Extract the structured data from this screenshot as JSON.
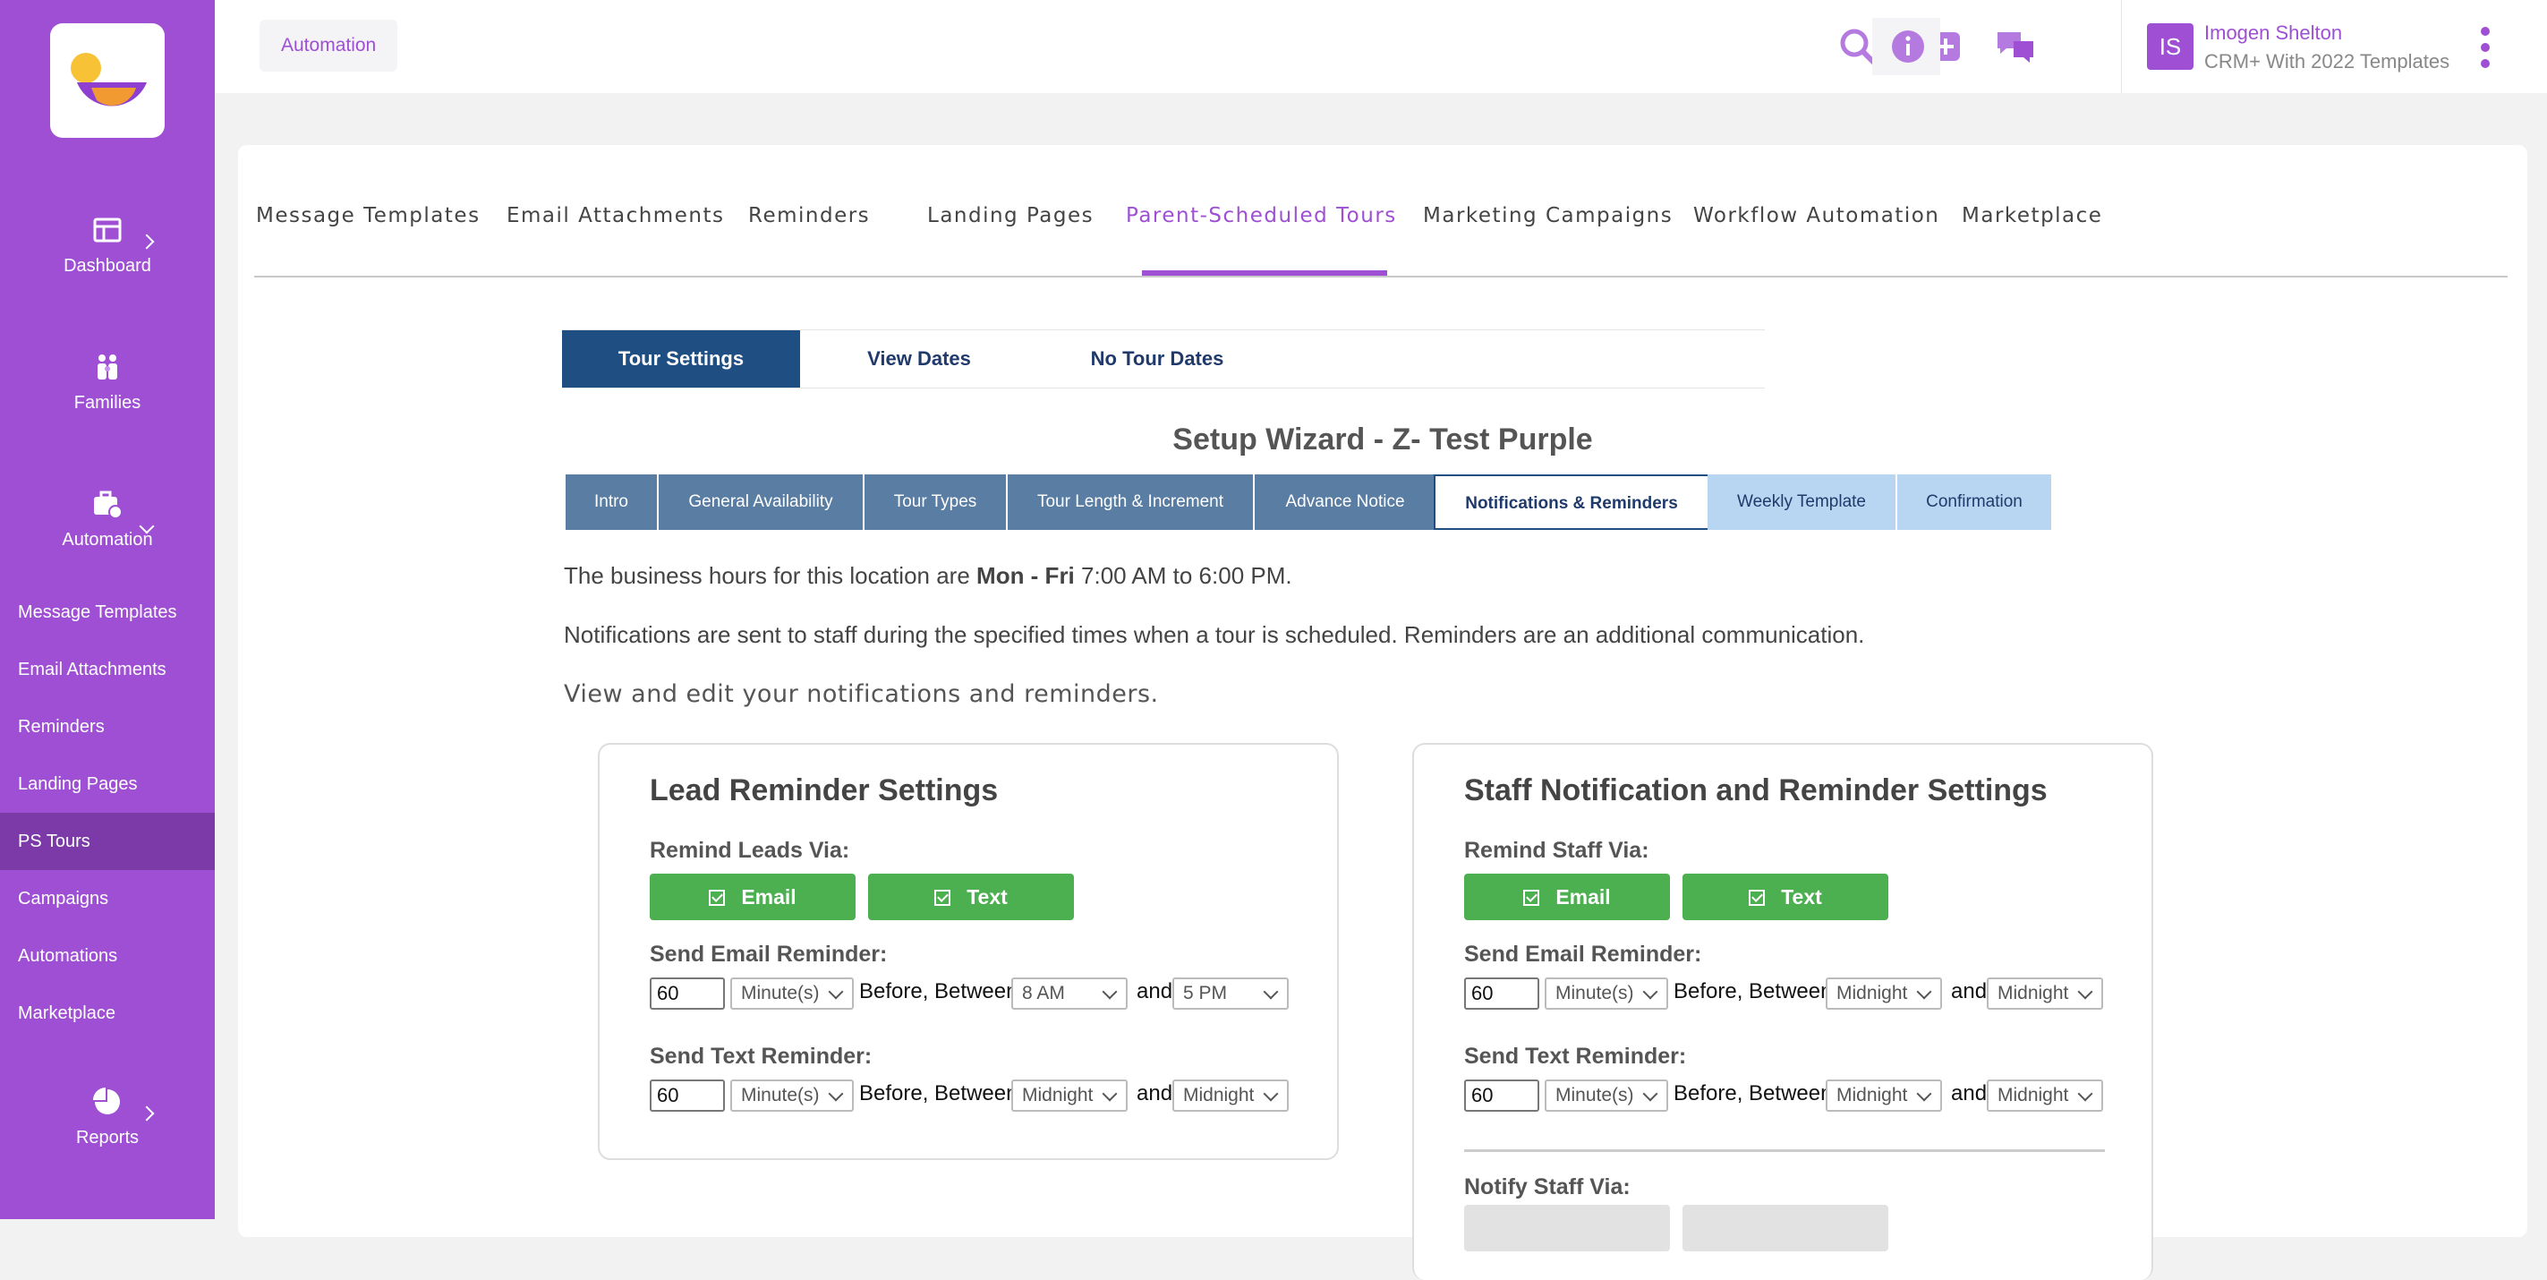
{
  "sidebar": {
    "main": [
      {
        "label": "Dashboard",
        "icon": "dashboard-icon"
      },
      {
        "label": "Families",
        "icon": "families-icon"
      },
      {
        "label": "Automation",
        "icon": "automation-icon"
      },
      {
        "label": "Reports",
        "icon": "reports-icon"
      }
    ],
    "sub": [
      "Message Templates",
      "Email Attachments",
      "Reminders",
      "Landing Pages",
      "PS Tours",
      "Campaigns",
      "Automations",
      "Marketplace"
    ],
    "active_sub": "PS Tours"
  },
  "topbar": {
    "breadcrumb": "Automation",
    "user_initials": "IS",
    "user_name": "Imogen Shelton",
    "user_org": "CRM+ With 2022 Templates"
  },
  "tabs": [
    "Message Templates",
    "Email Attachments",
    "Reminders",
    "Landing Pages",
    "Parent-Scheduled Tours",
    "Marketing Campaigns",
    "Workflow Automation",
    "Marketplace"
  ],
  "active_tab": "Parent-Scheduled Tours",
  "subtabs": [
    "Tour Settings",
    "View Dates",
    "No Tour Dates"
  ],
  "wizard": {
    "title": "Setup Wizard - Z- Test Purple",
    "steps": [
      "Intro",
      "General Availability",
      "Tour Types",
      "Tour Length & Increment",
      "Advance Notice",
      "Notifications & Reminders",
      "Weekly Template",
      "Confirmation"
    ],
    "active_step": "Notifications & Reminders"
  },
  "content": {
    "hours_prefix": "The business hours for this location are ",
    "hours_days": "Mon - Fri",
    "hours_time": " 7:00 AM to 6:00 PM.",
    "notice": "Notifications are sent to staff during the specified times when a tour is scheduled. Reminders are an additional communication.",
    "intro": "View and edit your notifications and reminders."
  },
  "lead": {
    "title": "Lead Reminder Settings",
    "remind_label": "Remind Leads Via:",
    "btn_email": "Email",
    "btn_text": "Text",
    "email_label": "Send Email Reminder:",
    "email_value": "60",
    "email_unit": "Minute(s)",
    "email_from": "8 AM",
    "email_to": "5 PM",
    "text_label": "Send Text Reminder:",
    "text_value": "60",
    "text_unit": "Minute(s)",
    "text_from": "Midnight",
    "text_to": "Midnight",
    "before_between": "Before, Between",
    "and": "and"
  },
  "staff": {
    "title": "Staff Notification and Reminder Settings",
    "remind_label": "Remind Staff Via:",
    "btn_email": "Email",
    "btn_text": "Text",
    "email_label": "Send Email Reminder:",
    "email_value": "60",
    "email_unit": "Minute(s)",
    "email_from": "Midnight",
    "email_to": "Midnight",
    "text_label": "Send Text Reminder:",
    "text_value": "60",
    "text_unit": "Minute(s)",
    "text_from": "Midnight",
    "text_to": "Midnight",
    "notify_label": "Notify Staff Via:",
    "before_between": "Before, Between",
    "and": "and"
  },
  "colors": {
    "brand": "#9e4fd3",
    "sidebar_active": "#7c3aa8",
    "navy": "#1f4e82",
    "green": "#4caf50",
    "step": "#5a7da3",
    "step_next": "#b8d6f2"
  }
}
